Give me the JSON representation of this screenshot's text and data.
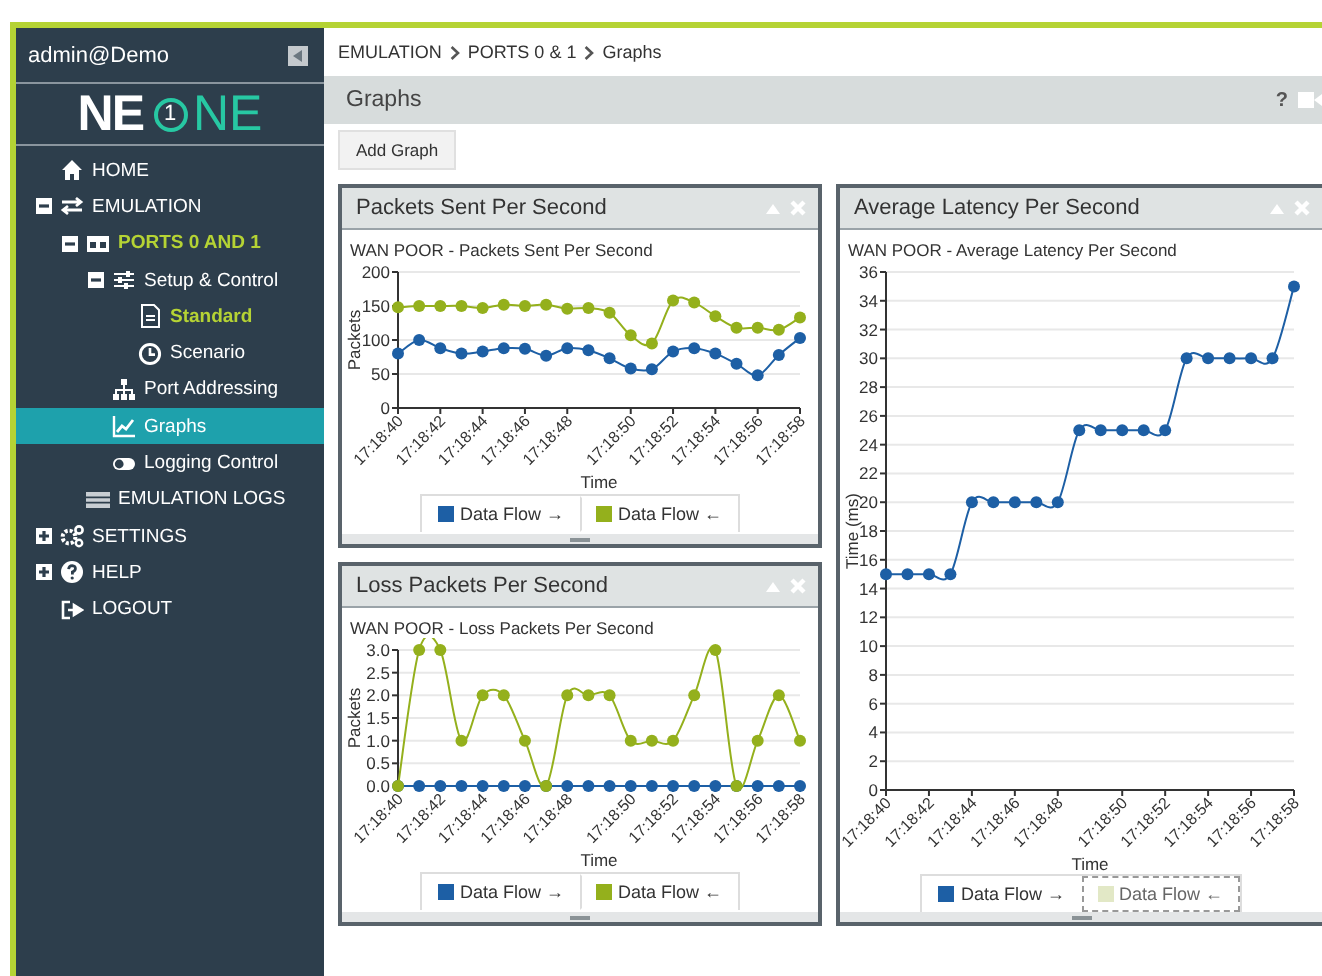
{
  "sidebar": {
    "user": "admin@Demo",
    "logo": {
      "left": "NE",
      "badge": "1",
      "right": "NE"
    },
    "items": [
      {
        "label": "HOME",
        "selected": false,
        "highlighted": false
      },
      {
        "label": "EMULATION",
        "selected": false,
        "highlighted": false,
        "expanded": true,
        "children": [
          {
            "label": "PORTS 0 AND 1",
            "selected": false,
            "highlighted": true,
            "expanded": true,
            "children": [
              {
                "label": "Setup & Control",
                "selected": false,
                "highlighted": false,
                "expanded": true,
                "children": [
                  {
                    "label": "Standard",
                    "selected": false,
                    "highlighted": true
                  },
                  {
                    "label": "Scenario",
                    "selected": false,
                    "highlighted": false
                  }
                ]
              },
              {
                "label": "Port Addressing",
                "selected": false,
                "highlighted": false
              },
              {
                "label": "Graphs",
                "selected": true,
                "highlighted": false
              },
              {
                "label": "Logging Control",
                "selected": false,
                "highlighted": false
              }
            ]
          },
          {
            "label": "EMULATION LOGS",
            "selected": false,
            "highlighted": false
          }
        ]
      },
      {
        "label": "SETTINGS",
        "selected": false,
        "highlighted": false,
        "expanded": false
      },
      {
        "label": "HELP",
        "selected": false,
        "highlighted": false,
        "expanded": false
      },
      {
        "label": "LOGOUT",
        "selected": false,
        "highlighted": false
      }
    ]
  },
  "breadcrumb": [
    "EMULATION",
    "PORTS 0 & 1",
    "Graphs"
  ],
  "page_header": {
    "title": "Graphs",
    "help": "?"
  },
  "add_button": "Add Graph",
  "panels": [
    {
      "title": "Packets Sent Per Second",
      "legend_items": [
        {
          "hidden": false
        },
        {
          "hidden": false
        }
      ],
      "chart_data": {
        "type": "line",
        "title": "WAN POOR - Packets Sent Per Second",
        "xlabel": "Time",
        "ylabel": "Packets",
        "grid": true,
        "legend": true,
        "categories": [
          "17:18:40",
          null,
          "17:18:42",
          null,
          "17:18:44",
          null,
          "17:18:46",
          null,
          "17:18:48",
          null,
          null,
          "17:18:50",
          null,
          "17:18:52",
          null,
          "17:18:54",
          null,
          "17:18:56",
          null,
          "17:18:58"
        ],
        "ylim": [
          0,
          200
        ],
        "yticks": [
          0,
          50,
          100,
          150,
          200
        ],
        "series": [
          {
            "name": "Data Flow →",
            "color": "#1d5fa5",
            "marker": "circle",
            "values": [
              80,
              100,
              88,
              80,
              83,
              88,
              87,
              77,
              88,
              85,
              73,
              58,
              57,
              83,
              88,
              80,
              65,
              48,
              78,
              103
            ]
          },
          {
            "name": "Data Flow ←",
            "color": "#94b01c",
            "marker": "circle",
            "values": [
              148,
              150,
              150,
              150,
              147,
              152,
              150,
              152,
              146,
              147,
              140,
              107,
              95,
              158,
              155,
              135,
              118,
              118,
              115,
              133
            ]
          }
        ]
      }
    },
    {
      "title": "Average Latency Per Second",
      "legend_items": [
        {
          "hidden": false
        },
        {
          "hidden": true
        }
      ],
      "chart_data": {
        "type": "line",
        "title": "WAN POOR - Average Latency Per Second",
        "xlabel": "Time",
        "ylabel": "Time (ms)",
        "grid": true,
        "legend": true,
        "categories": [
          "17:18:40",
          null,
          "17:18:42",
          null,
          "17:18:44",
          null,
          "17:18:46",
          null,
          "17:18:48",
          null,
          null,
          "17:18:50",
          null,
          "17:18:52",
          null,
          "17:18:54",
          null,
          "17:18:56",
          null,
          "17:18:58"
        ],
        "ylim": [
          0,
          36
        ],
        "yticks": [
          0,
          2,
          4,
          6,
          8,
          10,
          12,
          14,
          16,
          18,
          20,
          22,
          24,
          26,
          28,
          30,
          32,
          34,
          36
        ],
        "series": [
          {
            "name": "Data Flow →",
            "color": "#1d5fa5",
            "marker": "circle",
            "values": [
              15,
              15,
              15,
              15,
              20,
              20,
              20,
              20,
              20,
              25,
              25,
              25,
              25,
              25,
              30,
              30,
              30,
              30,
              30,
              35
            ]
          },
          {
            "name": "Data Flow ←",
            "color": "#e2e8c6",
            "values": [
              null,
              null,
              null,
              null,
              null,
              null,
              null,
              null,
              null,
              null,
              null,
              null,
              null,
              null,
              null,
              null,
              null,
              null,
              null,
              null
            ]
          }
        ]
      }
    },
    {
      "title": "Loss Packets Per Second",
      "legend_items": [
        {
          "hidden": false
        },
        {
          "hidden": false
        }
      ],
      "chart_data": {
        "type": "line",
        "title": "WAN POOR - Loss Packets Per Second",
        "xlabel": "Time",
        "ylabel": "Packets",
        "grid": true,
        "legend": true,
        "categories": [
          "17:18:40",
          null,
          "17:18:42",
          null,
          "17:18:44",
          null,
          "17:18:46",
          null,
          "17:18:48",
          null,
          null,
          "17:18:50",
          null,
          "17:18:52",
          null,
          "17:18:54",
          null,
          "17:18:56",
          null,
          "17:18:58"
        ],
        "ylim": [
          0,
          3
        ],
        "yticks": [
          {
            "value": 0,
            "label": "0.0"
          },
          {
            "value": 0.5,
            "label": "0.5"
          },
          {
            "value": 1,
            "label": "1.0"
          },
          {
            "value": 1.5,
            "label": "1.5"
          },
          {
            "value": 2,
            "label": "2.0"
          },
          {
            "value": 2.5,
            "label": "2.5"
          },
          {
            "value": 3,
            "label": "3.0"
          }
        ],
        "series": [
          {
            "name": "Data Flow →",
            "color": "#1d5fa5",
            "marker": "circle",
            "values": [
              0,
              0,
              0,
              0,
              0,
              0,
              0,
              0,
              0,
              0,
              0,
              0,
              0,
              0,
              0,
              0,
              0,
              0,
              0,
              0
            ]
          },
          {
            "name": "Data Flow ←",
            "color": "#94b01c",
            "marker": "circle",
            "values": [
              0,
              3,
              3,
              1,
              2,
              2,
              1,
              0,
              2,
              2,
              2,
              1,
              1,
              1,
              2,
              3,
              0,
              1,
              2,
              1
            ]
          }
        ]
      }
    }
  ]
}
